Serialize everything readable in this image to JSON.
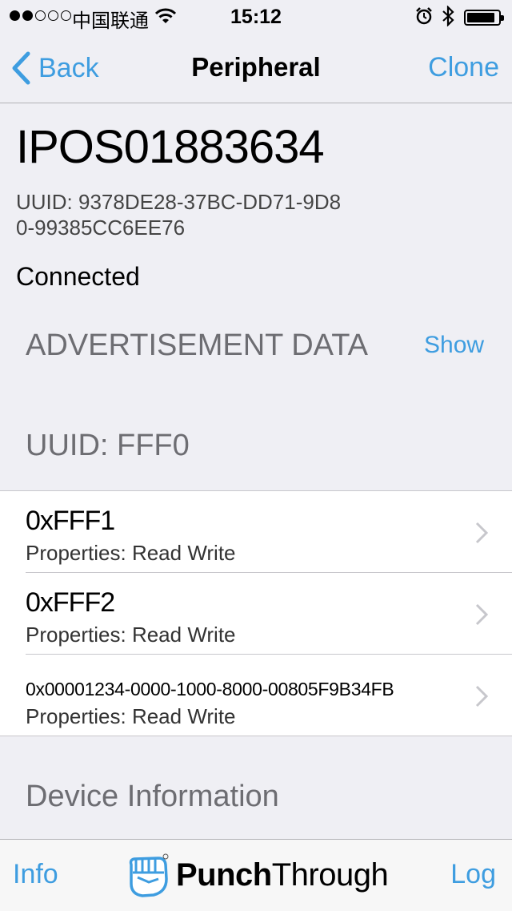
{
  "status": {
    "carrier": "中国联通",
    "time": "15:12"
  },
  "nav": {
    "back_label": "Back",
    "title": "Peripheral",
    "clone_label": "Clone"
  },
  "device": {
    "name": "IPOS01883634",
    "uuid": "UUID: 9378DE28-37BC-DD71-9D80-99385CC6EE76",
    "state": "Connected"
  },
  "advertisement": {
    "title": "ADVERTISEMENT DATA",
    "show_label": "Show"
  },
  "service": {
    "title": "UUID: FFF0",
    "characteristics": [
      {
        "name": "0xFFF1",
        "props": "Properties: Read Write"
      },
      {
        "name": "0xFFF2",
        "props": "Properties: Read Write"
      },
      {
        "name": "0x00001234-0000-1000-8000-00805F9B34FB",
        "props": "Properties: Read Write"
      }
    ]
  },
  "device_info_title": "Device Information",
  "tabbar": {
    "info_label": "Info",
    "log_label": "Log",
    "brand_bold": "Punch",
    "brand_regular": "Through",
    "brand_mark": "fist-logo-icon"
  },
  "colors": {
    "accent": "#3e9de0",
    "background": "#efeff4",
    "section_header": "#6d6d72"
  }
}
